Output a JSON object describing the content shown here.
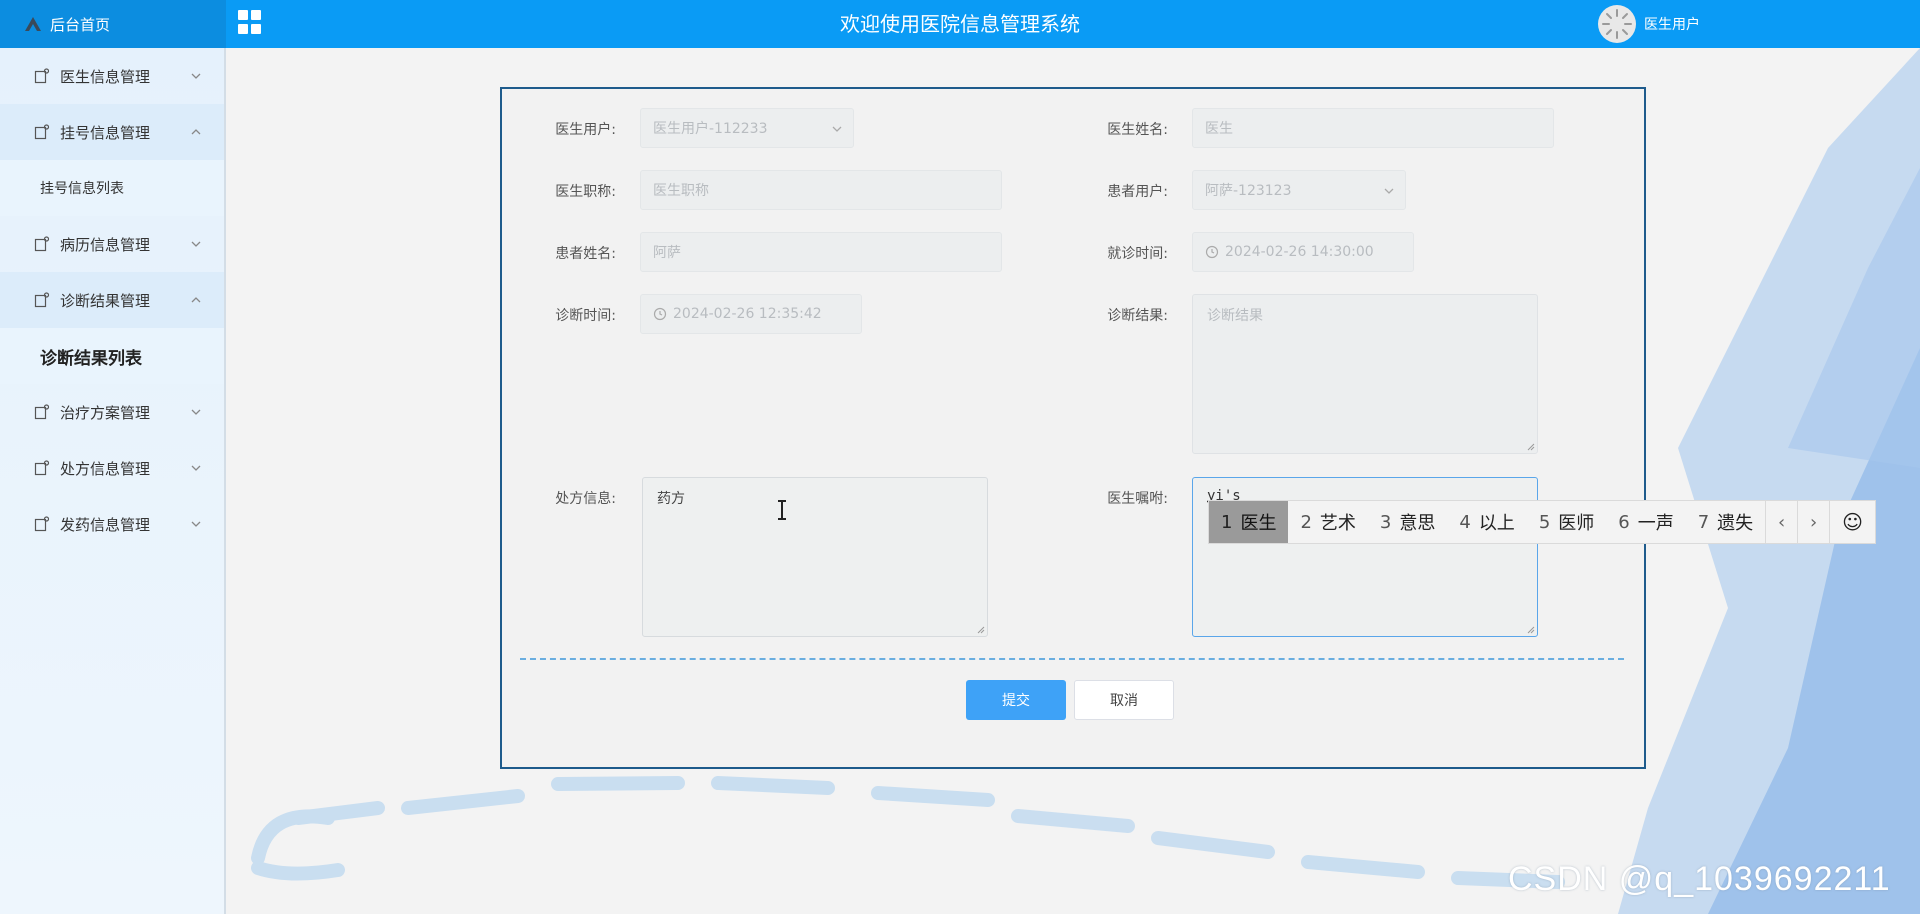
{
  "header": {
    "brand": "后台首页",
    "title": "欢迎使用医院信息管理系统",
    "user": "医生用户"
  },
  "sidebar": {
    "items": [
      {
        "label": "医生信息管理"
      },
      {
        "label": "挂号信息管理",
        "sub": "挂号信息列表"
      },
      {
        "label": "病历信息管理"
      },
      {
        "label": "诊断结果管理",
        "sub": "诊断结果列表"
      },
      {
        "label": "治疗方案管理"
      },
      {
        "label": "处方信息管理"
      },
      {
        "label": "发药信息管理"
      }
    ]
  },
  "form": {
    "doctor_user": {
      "label": "医生用户:",
      "value": "医生用户-112233"
    },
    "doctor_name": {
      "label": "医生姓名:",
      "placeholder": "医生"
    },
    "doctor_title": {
      "label": "医生职称:",
      "placeholder": "医生职称"
    },
    "patient_user": {
      "label": "患者用户:",
      "value": "阿萨-123123"
    },
    "patient_name": {
      "label": "患者姓名:",
      "value": "阿萨"
    },
    "visit_time": {
      "label": "就诊时间:",
      "value": "2024-02-26 14:30:00"
    },
    "diagnosis_time": {
      "label": "诊断时间:",
      "value": "2024-02-26 12:35:42"
    },
    "diagnosis_result": {
      "label": "诊断结果:",
      "placeholder": "诊断结果"
    },
    "prescription": {
      "label": "处方信息:",
      "value": "药方"
    },
    "doctor_advice": {
      "label": "医生嘱咐:",
      "value": "yi's"
    },
    "submit": "提交",
    "cancel": "取消"
  },
  "ime": {
    "candidates": [
      {
        "num": "1",
        "text": "医生"
      },
      {
        "num": "2",
        "text": "艺术"
      },
      {
        "num": "3",
        "text": "意思"
      },
      {
        "num": "4",
        "text": "以上"
      },
      {
        "num": "5",
        "text": "医师"
      },
      {
        "num": "6",
        "text": "一声"
      },
      {
        "num": "7",
        "text": "遗失"
      }
    ],
    "prev": "‹",
    "next": "›",
    "emoji": "☺"
  },
  "watermark": "CSDN @q_1039692211"
}
